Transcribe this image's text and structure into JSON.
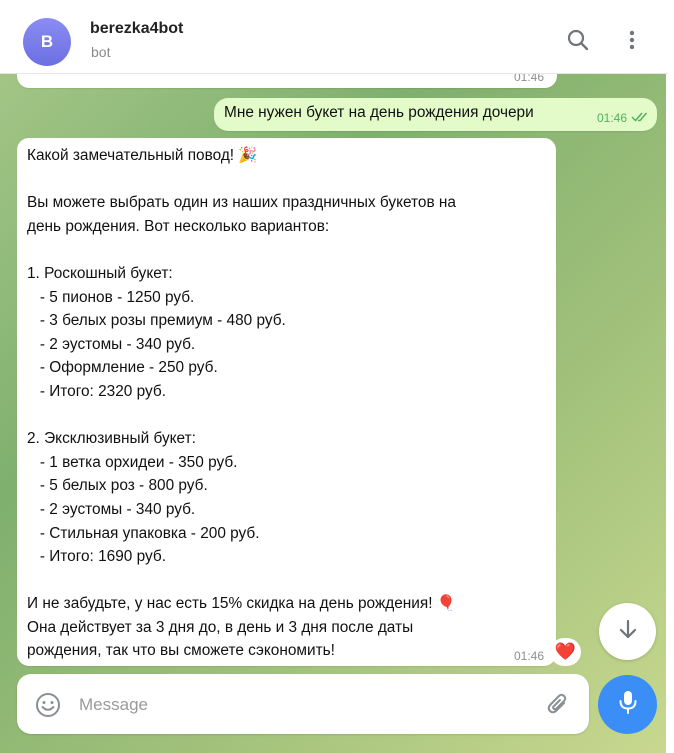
{
  "header": {
    "avatar_letter": "B",
    "title": "berezka4bot",
    "subtitle": "bot",
    "search_icon": "search-icon",
    "menu_icon": "more-vertical-icon"
  },
  "previous_message": {
    "time": "01:46"
  },
  "outgoing_message": {
    "text": "Мне нужен букет на день рождения дочери",
    "time": "01:46",
    "status": "read"
  },
  "incoming_message": {
    "lines": [
      "Какой замечательный повод! 🎉",
      "",
      "Вы можете выбрать один из наших праздничных букетов на",
      "день рождения. Вот несколько вариантов:",
      "",
      "1. Роскошный букет:",
      "   - 5 пионов - 1250 руб.",
      "   - 3 белых розы премиум - 480 руб.",
      "   - 2 эустомы - 340 руб.",
      "   - Оформление - 250 руб.",
      "   - Итого: 2320 руб.",
      "",
      "2. Эксклюзивный букет:",
      "   - 1 ветка орхидеи - 350 руб.",
      "   - 5 белых роз - 800 руб.",
      "   - 2 эустомы - 340 руб.",
      "   - Стильная упаковка - 200 руб.",
      "   - Итого: 1690 руб.",
      "",
      "И не забудьте, у нас есть 15% скидка на день рождения! 🎈",
      "Она действует за 3 дня до, в день и 3 дня после даты",
      "рождения, так что вы сможете сэкономить!"
    ],
    "time": "01:46",
    "reaction": "❤️"
  },
  "composer": {
    "placeholder": "Message",
    "emoji_icon": "emoji-icon",
    "attach_icon": "paperclip-icon",
    "mic_icon": "microphone-icon"
  },
  "scroll_down_icon": "arrow-down-icon",
  "colors": {
    "accent": "#3a8ef5",
    "avatar": "#7b7deb",
    "outgoing_bubble": "#e3fbc9",
    "read_check": "#52b05c"
  }
}
